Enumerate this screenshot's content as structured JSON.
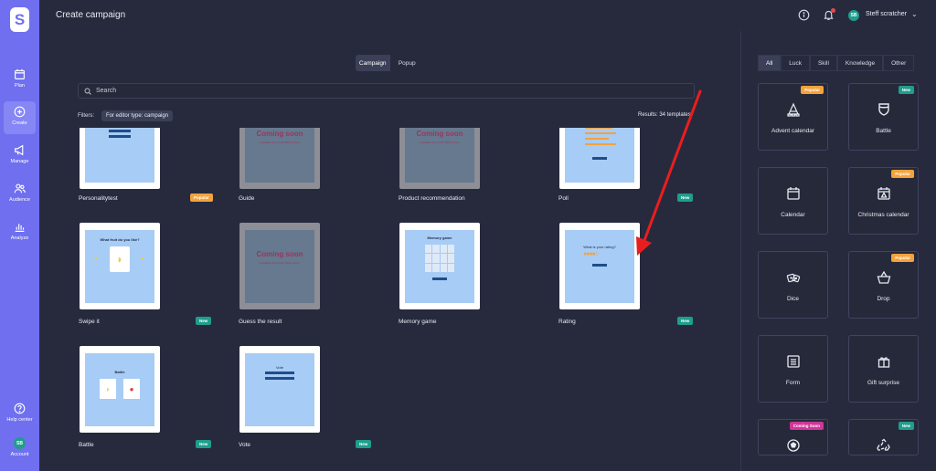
{
  "topbar": {
    "title": "Create campaign",
    "username": "Steff scratcher",
    "avatar_initials": "SB"
  },
  "sidebar": {
    "logo": "S",
    "items": [
      {
        "label": "Plan",
        "icon": "calendar-icon"
      },
      {
        "label": "Create",
        "icon": "plus-circle-icon"
      },
      {
        "label": "Manage",
        "icon": "megaphone-icon"
      },
      {
        "label": "Audience",
        "icon": "users-icon"
      },
      {
        "label": "Analyze",
        "icon": "bar-chart-icon"
      }
    ],
    "help_label": "Help center",
    "account_label": "Account",
    "account_initials": "SB"
  },
  "toggle": {
    "campaign": "Campaign",
    "popup": "Popup"
  },
  "search": {
    "placeholder": "Search"
  },
  "filters": {
    "label": "Filters:",
    "chip": "For editor type: campaign",
    "results": "Results: 34 templates"
  },
  "templates": [
    {
      "name": "Personalitytest",
      "tag": "Popular",
      "tagtype": "pop"
    },
    {
      "name": "Guide",
      "tag": "",
      "coming": "Coming soon",
      "coming_sub": "Available this month 2025 Lorem"
    },
    {
      "name": "Product recommendation",
      "tag": "",
      "coming": "Coming soon",
      "coming_sub": "Available this month 2025 Lorem"
    },
    {
      "name": "Poll",
      "tag": "New",
      "tagtype": "new"
    },
    {
      "name": "Swipe it",
      "tag": "New",
      "tagtype": "new",
      "heading": "What fruit do you like?"
    },
    {
      "name": "Guess the result",
      "tag": "",
      "coming": "Coming soon",
      "coming_sub": "Available this month 2025 Lorem"
    },
    {
      "name": "Memory game",
      "tag": "",
      "heading": "Memory game"
    },
    {
      "name": "Rating",
      "tag": "New",
      "tagtype": "new",
      "heading": "What is your rating?"
    },
    {
      "name": "Battle",
      "tag": "New",
      "tagtype": "new",
      "heading": "Battle"
    },
    {
      "name": "Vote",
      "tag": "New",
      "tagtype": "new",
      "heading": "Vote"
    }
  ],
  "right_tabs": [
    "All",
    "Luck",
    "Skill",
    "Knowledge",
    "Other"
  ],
  "games": [
    {
      "name": "Advent calendar",
      "tag": "Popular",
      "tagtype": "pop",
      "icon": "tree-icon"
    },
    {
      "name": "Battle",
      "tag": "New",
      "tagtype": "new",
      "icon": "shield-icon"
    },
    {
      "name": "Calendar",
      "tag": "",
      "icon": "calendar-icon"
    },
    {
      "name": "Christmas calendar",
      "tag": "Popular",
      "tagtype": "pop",
      "icon": "calendar-tree-icon"
    },
    {
      "name": "Dice",
      "tag": "",
      "icon": "dice-icon"
    },
    {
      "name": "Drop",
      "tag": "Popular",
      "tagtype": "pop",
      "icon": "basket-icon"
    },
    {
      "name": "Form",
      "tag": "",
      "icon": "form-icon"
    },
    {
      "name": "Gift surprise",
      "tag": "",
      "icon": "gift-icon"
    },
    {
      "name": "",
      "tag": "Coming Soon",
      "tagtype": "soon",
      "icon": "football-icon"
    },
    {
      "name": "",
      "tag": "New",
      "tagtype": "new",
      "icon": "recycle-icon"
    }
  ]
}
